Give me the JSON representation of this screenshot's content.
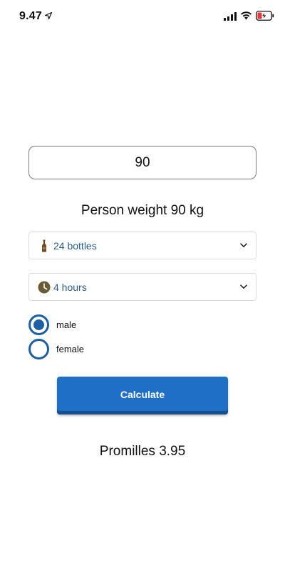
{
  "status_bar": {
    "time": "9.47"
  },
  "weight": {
    "value": "90",
    "label": "Person weight 90 kg"
  },
  "bottles_select": {
    "selected": "24 bottles",
    "icon": "bottle-icon"
  },
  "hours_select": {
    "selected": "4 hours",
    "icon": "clock-icon"
  },
  "gender": {
    "options": [
      {
        "label": "male",
        "selected": true
      },
      {
        "label": "female",
        "selected": false
      }
    ]
  },
  "calculate_button": {
    "label": "Calculate"
  },
  "result": {
    "text": "Promilles 3.95"
  },
  "colors": {
    "accent": "#1d5fa3",
    "button": "#1f6fc7",
    "select_text": "#2a5d8f",
    "icon_brown": "#6b4a22"
  }
}
